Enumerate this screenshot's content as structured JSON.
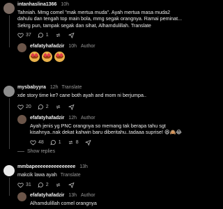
{
  "comments": [
    {
      "user": "intanhaslina1366",
      "time": "10h",
      "translate": "Translate",
      "text": "Tahniah. Mmg comel \"mak mertua muda\". Ayah mertua masa muda2 dahulu dan tengah top main bola, mmg segak orangnya. Ramai peminat... Sekrg pun, tampak segak dan sihat, Alhamdulillah.",
      "translate2": "Translate",
      "likes": "37",
      "replies": "1",
      "avatar_color": "#7a6a62"
    },
    {
      "user": "efafatyhafadzir",
      "time": "10h",
      "author_badge": "Author",
      "emojis": [
        "heart-eyes-emoji",
        "heart-eyes-emoji",
        "heart-eyes-emoji"
      ],
      "avatar_color": "#6b5549"
    },
    {
      "user": "mysbabyyra",
      "time": "12h",
      "translate": "Translate",
      "text": "xde story time ke? cane both ayah and mom ni berjumpa..",
      "likes": "20",
      "replies": "2",
      "avatar_color": "#8d8d8d"
    },
    {
      "user": "efafatyhafadzir",
      "time": "12h",
      "author_badge": "Author",
      "text": "Ayah jenis yg PNC orangnya so memang tak berapa tahu sgt kisahnya..nak dekat kahwin baru diberitahu..tadaaa suprise! 😆🙈😂",
      "likes": "48",
      "replies": "1",
      "shares": "8",
      "show_replies": "Show replies",
      "avatar_color": "#6b5549"
    },
    {
      "user": "mmbapeeeeeeeeeeeeeee",
      "time": "13h",
      "text": "makcik lawa ayah",
      "translate": "Translate",
      "likes": "31",
      "replies": "2",
      "avatar_color": "#e8e8e8"
    },
    {
      "user": "efafatyhafadzir",
      "time": "13h",
      "author_badge": "Author",
      "text": "Alhamdulillah comel orangnya",
      "avatar_color": "#6b5549"
    }
  ],
  "colors": {
    "background": "#000000",
    "thread_line": "#3e3e3e",
    "muted_text": "#9a9a9a"
  }
}
